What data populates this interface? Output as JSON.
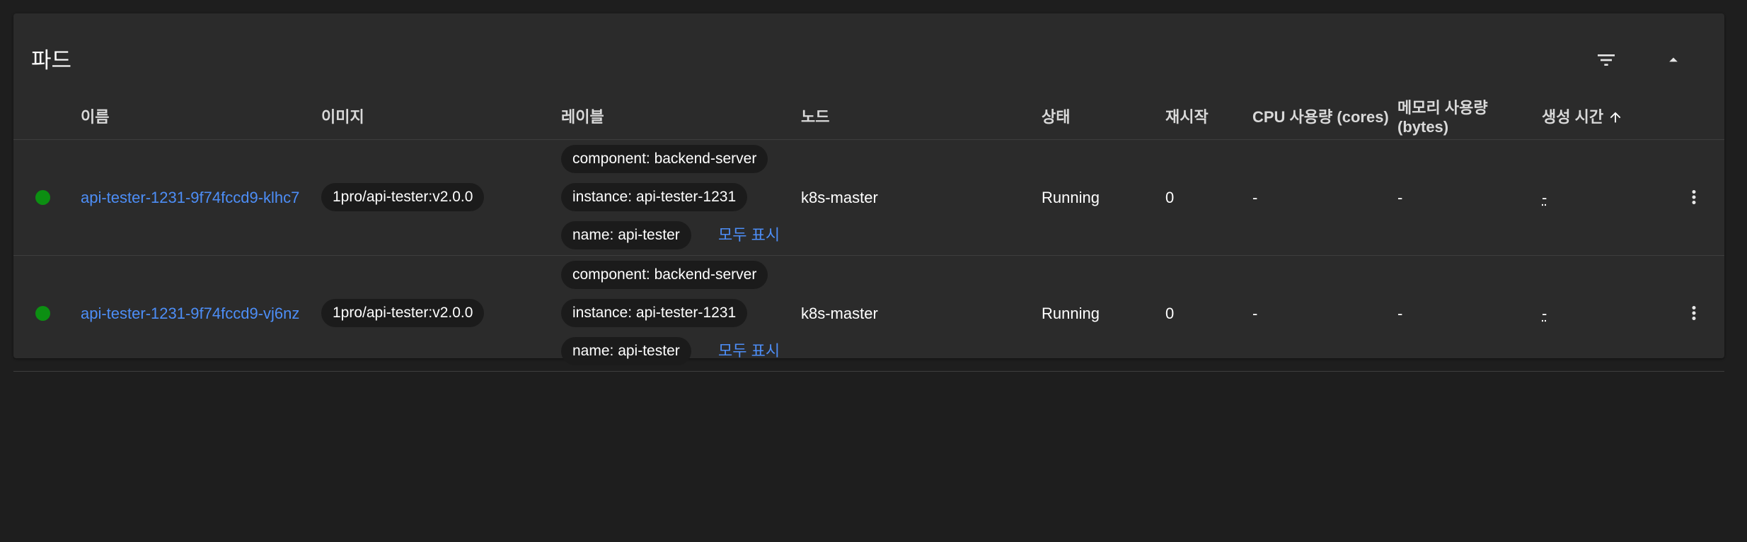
{
  "card": {
    "title": "파드"
  },
  "toolbar": {
    "filter_icon": "filter-icon",
    "collapse_icon": "chevron-up-icon"
  },
  "table": {
    "columns": {
      "name": "이름",
      "image": "이미지",
      "labels": "레이블",
      "node": "노드",
      "status": "상태",
      "restarts": "재시작",
      "cpu_line1": "CPU 사용량 (cores)",
      "memory_line1": "메모리 사용량",
      "memory_line2": "(bytes)",
      "created": "생성 시간",
      "sort_icon": "arrow-up-icon"
    },
    "rows": [
      {
        "status_color": "#0c8f12",
        "name": "api-tester-1231-9f74fccd9-klhc7",
        "image": "1pro/api-tester:v2.0.0",
        "labels": [
          "component: backend-server",
          "instance: api-tester-1231",
          "name: api-tester"
        ],
        "show_all": "모두 표시",
        "node": "k8s-master",
        "status": "Running",
        "restarts": "0",
        "cpu": "-",
        "memory": "-",
        "created": "-"
      },
      {
        "status_color": "#0c8f12",
        "name": "api-tester-1231-9f74fccd9-vj6nz",
        "image": "1pro/api-tester:v2.0.0",
        "labels": [
          "component: backend-server",
          "instance: api-tester-1231",
          "name: api-tester"
        ],
        "show_all": "모두 표시",
        "node": "k8s-master",
        "status": "Running",
        "restarts": "0",
        "cpu": "-",
        "memory": "-",
        "created": "-"
      }
    ]
  },
  "colors": {
    "background": "#1e1e1e",
    "card": "#2b2b2b",
    "link": "#4d8ef7",
    "running": "#0c8f12"
  }
}
